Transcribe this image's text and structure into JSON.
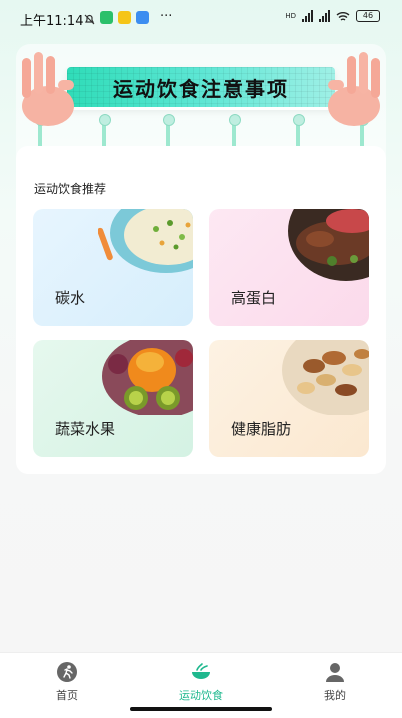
{
  "status_bar": {
    "time": "上午11:14",
    "network_label": "HD",
    "battery": "46",
    "more": "···"
  },
  "banner": {
    "title": "运动饮食注意事项"
  },
  "recommend": {
    "section_title": "运动饮食推荐",
    "items": [
      {
        "label": "碳水",
        "icon": "rice-bowl-image"
      },
      {
        "label": "高蛋白",
        "icon": "steak-image"
      },
      {
        "label": "蔬菜水果",
        "icon": "fruit-basket-image"
      },
      {
        "label": "健康脂肪",
        "icon": "nuts-image"
      }
    ]
  },
  "bottom_nav": {
    "items": [
      {
        "label": "首页",
        "icon": "runner-icon"
      },
      {
        "label": "运动饮食",
        "icon": "food-bowl-icon"
      },
      {
        "label": "我的",
        "icon": "user-icon"
      }
    ],
    "active_index": 1,
    "accent": "#1fb88e"
  },
  "colors": {
    "banner_board": "#2fdcb8",
    "tile_carbs": "#e2f3fd",
    "tile_protein": "#fce3f0",
    "tile_vegfruit": "#ddf5e8",
    "tile_fat": "#fcefdc"
  }
}
